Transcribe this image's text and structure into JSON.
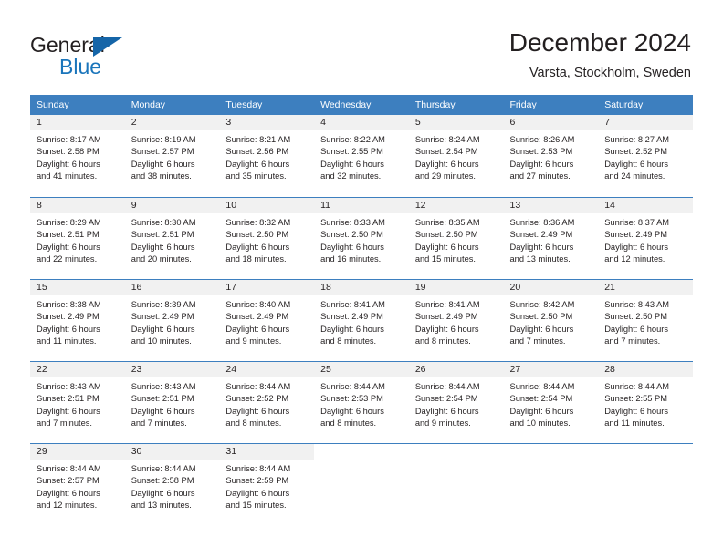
{
  "brand": {
    "name_part1": "General",
    "name_part2": "Blue",
    "flag_icon": "blue-triangle-flag-icon"
  },
  "header": {
    "title": "December 2024",
    "location": "Varsta, Stockholm, Sweden"
  },
  "colors": {
    "header_blue": "#3d7fbf",
    "brand_blue": "#1a75bb",
    "daynum_band": "#f1f1f1",
    "text": "#231f20"
  },
  "weekday_headers": [
    "Sunday",
    "Monday",
    "Tuesday",
    "Wednesday",
    "Thursday",
    "Friday",
    "Saturday"
  ],
  "weeks": [
    [
      {
        "day": "1",
        "sunrise": "Sunrise: 8:17 AM",
        "sunset": "Sunset: 2:58 PM",
        "daylight1": "Daylight: 6 hours",
        "daylight2": "and 41 minutes."
      },
      {
        "day": "2",
        "sunrise": "Sunrise: 8:19 AM",
        "sunset": "Sunset: 2:57 PM",
        "daylight1": "Daylight: 6 hours",
        "daylight2": "and 38 minutes."
      },
      {
        "day": "3",
        "sunrise": "Sunrise: 8:21 AM",
        "sunset": "Sunset: 2:56 PM",
        "daylight1": "Daylight: 6 hours",
        "daylight2": "and 35 minutes."
      },
      {
        "day": "4",
        "sunrise": "Sunrise: 8:22 AM",
        "sunset": "Sunset: 2:55 PM",
        "daylight1": "Daylight: 6 hours",
        "daylight2": "and 32 minutes."
      },
      {
        "day": "5",
        "sunrise": "Sunrise: 8:24 AM",
        "sunset": "Sunset: 2:54 PM",
        "daylight1": "Daylight: 6 hours",
        "daylight2": "and 29 minutes."
      },
      {
        "day": "6",
        "sunrise": "Sunrise: 8:26 AM",
        "sunset": "Sunset: 2:53 PM",
        "daylight1": "Daylight: 6 hours",
        "daylight2": "and 27 minutes."
      },
      {
        "day": "7",
        "sunrise": "Sunrise: 8:27 AM",
        "sunset": "Sunset: 2:52 PM",
        "daylight1": "Daylight: 6 hours",
        "daylight2": "and 24 minutes."
      }
    ],
    [
      {
        "day": "8",
        "sunrise": "Sunrise: 8:29 AM",
        "sunset": "Sunset: 2:51 PM",
        "daylight1": "Daylight: 6 hours",
        "daylight2": "and 22 minutes."
      },
      {
        "day": "9",
        "sunrise": "Sunrise: 8:30 AM",
        "sunset": "Sunset: 2:51 PM",
        "daylight1": "Daylight: 6 hours",
        "daylight2": "and 20 minutes."
      },
      {
        "day": "10",
        "sunrise": "Sunrise: 8:32 AM",
        "sunset": "Sunset: 2:50 PM",
        "daylight1": "Daylight: 6 hours",
        "daylight2": "and 18 minutes."
      },
      {
        "day": "11",
        "sunrise": "Sunrise: 8:33 AM",
        "sunset": "Sunset: 2:50 PM",
        "daylight1": "Daylight: 6 hours",
        "daylight2": "and 16 minutes."
      },
      {
        "day": "12",
        "sunrise": "Sunrise: 8:35 AM",
        "sunset": "Sunset: 2:50 PM",
        "daylight1": "Daylight: 6 hours",
        "daylight2": "and 15 minutes."
      },
      {
        "day": "13",
        "sunrise": "Sunrise: 8:36 AM",
        "sunset": "Sunset: 2:49 PM",
        "daylight1": "Daylight: 6 hours",
        "daylight2": "and 13 minutes."
      },
      {
        "day": "14",
        "sunrise": "Sunrise: 8:37 AM",
        "sunset": "Sunset: 2:49 PM",
        "daylight1": "Daylight: 6 hours",
        "daylight2": "and 12 minutes."
      }
    ],
    [
      {
        "day": "15",
        "sunrise": "Sunrise: 8:38 AM",
        "sunset": "Sunset: 2:49 PM",
        "daylight1": "Daylight: 6 hours",
        "daylight2": "and 11 minutes."
      },
      {
        "day": "16",
        "sunrise": "Sunrise: 8:39 AM",
        "sunset": "Sunset: 2:49 PM",
        "daylight1": "Daylight: 6 hours",
        "daylight2": "and 10 minutes."
      },
      {
        "day": "17",
        "sunrise": "Sunrise: 8:40 AM",
        "sunset": "Sunset: 2:49 PM",
        "daylight1": "Daylight: 6 hours",
        "daylight2": "and 9 minutes."
      },
      {
        "day": "18",
        "sunrise": "Sunrise: 8:41 AM",
        "sunset": "Sunset: 2:49 PM",
        "daylight1": "Daylight: 6 hours",
        "daylight2": "and 8 minutes."
      },
      {
        "day": "19",
        "sunrise": "Sunrise: 8:41 AM",
        "sunset": "Sunset: 2:49 PM",
        "daylight1": "Daylight: 6 hours",
        "daylight2": "and 8 minutes."
      },
      {
        "day": "20",
        "sunrise": "Sunrise: 8:42 AM",
        "sunset": "Sunset: 2:50 PM",
        "daylight1": "Daylight: 6 hours",
        "daylight2": "and 7 minutes."
      },
      {
        "day": "21",
        "sunrise": "Sunrise: 8:43 AM",
        "sunset": "Sunset: 2:50 PM",
        "daylight1": "Daylight: 6 hours",
        "daylight2": "and 7 minutes."
      }
    ],
    [
      {
        "day": "22",
        "sunrise": "Sunrise: 8:43 AM",
        "sunset": "Sunset: 2:51 PM",
        "daylight1": "Daylight: 6 hours",
        "daylight2": "and 7 minutes."
      },
      {
        "day": "23",
        "sunrise": "Sunrise: 8:43 AM",
        "sunset": "Sunset: 2:51 PM",
        "daylight1": "Daylight: 6 hours",
        "daylight2": "and 7 minutes."
      },
      {
        "day": "24",
        "sunrise": "Sunrise: 8:44 AM",
        "sunset": "Sunset: 2:52 PM",
        "daylight1": "Daylight: 6 hours",
        "daylight2": "and 8 minutes."
      },
      {
        "day": "25",
        "sunrise": "Sunrise: 8:44 AM",
        "sunset": "Sunset: 2:53 PM",
        "daylight1": "Daylight: 6 hours",
        "daylight2": "and 8 minutes."
      },
      {
        "day": "26",
        "sunrise": "Sunrise: 8:44 AM",
        "sunset": "Sunset: 2:54 PM",
        "daylight1": "Daylight: 6 hours",
        "daylight2": "and 9 minutes."
      },
      {
        "day": "27",
        "sunrise": "Sunrise: 8:44 AM",
        "sunset": "Sunset: 2:54 PM",
        "daylight1": "Daylight: 6 hours",
        "daylight2": "and 10 minutes."
      },
      {
        "day": "28",
        "sunrise": "Sunrise: 8:44 AM",
        "sunset": "Sunset: 2:55 PM",
        "daylight1": "Daylight: 6 hours",
        "daylight2": "and 11 minutes."
      }
    ],
    [
      {
        "day": "29",
        "sunrise": "Sunrise: 8:44 AM",
        "sunset": "Sunset: 2:57 PM",
        "daylight1": "Daylight: 6 hours",
        "daylight2": "and 12 minutes."
      },
      {
        "day": "30",
        "sunrise": "Sunrise: 8:44 AM",
        "sunset": "Sunset: 2:58 PM",
        "daylight1": "Daylight: 6 hours",
        "daylight2": "and 13 minutes."
      },
      {
        "day": "31",
        "sunrise": "Sunrise: 8:44 AM",
        "sunset": "Sunset: 2:59 PM",
        "daylight1": "Daylight: 6 hours",
        "daylight2": "and 15 minutes."
      },
      {
        "day": "",
        "sunrise": "",
        "sunset": "",
        "daylight1": "",
        "daylight2": ""
      },
      {
        "day": "",
        "sunrise": "",
        "sunset": "",
        "daylight1": "",
        "daylight2": ""
      },
      {
        "day": "",
        "sunrise": "",
        "sunset": "",
        "daylight1": "",
        "daylight2": ""
      },
      {
        "day": "",
        "sunrise": "",
        "sunset": "",
        "daylight1": "",
        "daylight2": ""
      }
    ]
  ]
}
